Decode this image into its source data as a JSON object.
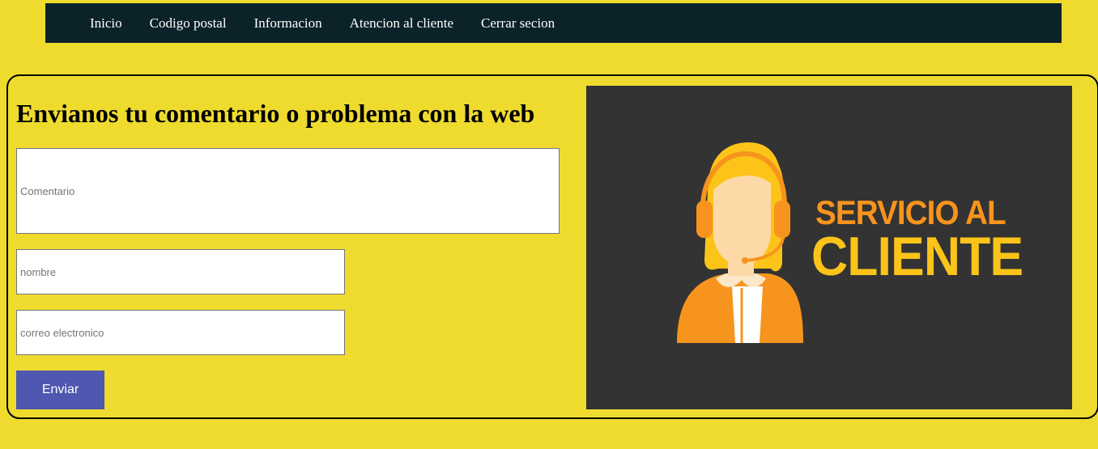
{
  "nav": {
    "items": [
      {
        "label": "Inicio"
      },
      {
        "label": "Codigo postal"
      },
      {
        "label": "Informacion"
      },
      {
        "label": "Atencion al cliente"
      },
      {
        "label": "Cerrar secion"
      }
    ]
  },
  "form": {
    "title": "Envianos tu comentario o problema con la web",
    "comment_placeholder": "Comentario",
    "comment_value": "",
    "name_placeholder": "nombre",
    "name_value": "",
    "email_placeholder": "correo electronico",
    "email_value": "",
    "submit_label": "Enviar"
  },
  "banner": {
    "line1": "SERVICIO AL",
    "line2": "CLIENTE"
  },
  "colors": {
    "page_background": "#eedb2e",
    "navbar_background": "#0c2229",
    "button_background": "#4f57b0",
    "banner_background": "#333333",
    "banner_orange": "#f7941d",
    "banner_yellow": "#fcc419"
  }
}
